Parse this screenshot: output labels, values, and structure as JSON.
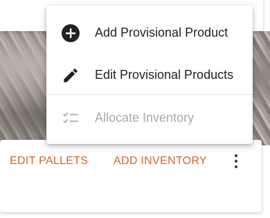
{
  "menu": {
    "items": [
      {
        "label": "Add Provisional Product",
        "icon": "add-circle-icon",
        "enabled": true
      },
      {
        "label": "Edit Provisional Products",
        "icon": "pencil-icon",
        "enabled": true
      },
      {
        "label": "Allocate Inventory",
        "icon": "checklist-icon",
        "enabled": false
      }
    ]
  },
  "actions": {
    "edit_pallets_label": "EDIT PALLETS",
    "add_inventory_label": "ADD INVENTORY",
    "more_icon": "more-vert-icon"
  },
  "colors": {
    "accent": "#d2622a",
    "disabled_text": "#a9a9a9",
    "text": "#222222",
    "icon": "#222222"
  }
}
